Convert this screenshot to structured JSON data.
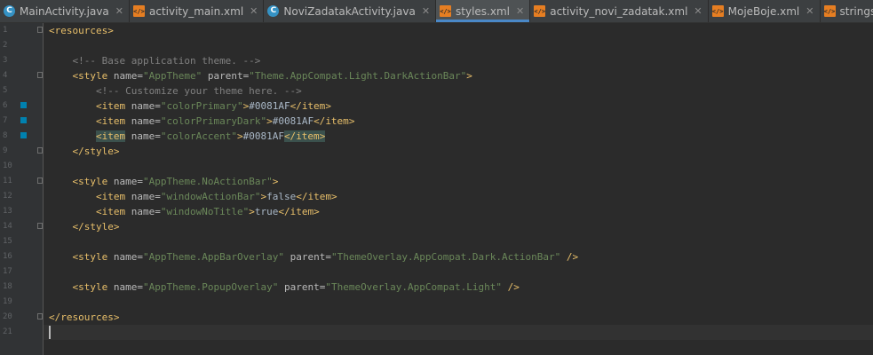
{
  "tabs": [
    {
      "label": "MainActivity.java",
      "kind": "java",
      "active": false
    },
    {
      "label": "activity_main.xml",
      "kind": "xml",
      "active": false
    },
    {
      "label": "NoviZadatakActivity.java",
      "kind": "java",
      "active": false
    },
    {
      "label": "styles.xml",
      "kind": "xml",
      "active": true
    },
    {
      "label": "activity_novi_zadatak.xml",
      "kind": "xml",
      "active": false
    },
    {
      "label": "MojeBoje.xml",
      "kind": "xml",
      "active": false
    },
    {
      "label": "strings.xml",
      "kind": "xml",
      "active": false
    }
  ],
  "icons": {
    "java": "java-class-icon",
    "xml": "xml-file-icon",
    "close": "close-icon"
  },
  "tokens": {
    "open_tag": "<",
    "close_tag": ">",
    "end_tag": "</",
    "self_close": " />",
    "equals": "=",
    "resources": "resources",
    "style": "style",
    "item": "item",
    "name": "name",
    "parent": "parent",
    "comment_1": "<!-- Base application theme. -->",
    "comment_2": "<!-- Customize your theme here. -->",
    "apptheme": "\"AppTheme\"",
    "parent_darkactionbar": "\"Theme.AppCompat.Light.DarkActionBar\"",
    "color_primary": "\"colorPrimary\"",
    "color_primary_dark": "\"colorPrimaryDark\"",
    "color_accent": "\"colorAccent\"",
    "color_value": "#0081AF",
    "noactionbar": "\"AppTheme.NoActionBar\"",
    "window_action_bar": "\"windowActionBar\"",
    "window_no_title": "\"windowNoTitle\"",
    "false": "false",
    "true": "true",
    "appbaroverlay": "\"AppTheme.AppBarOverlay\"",
    "parent_dark_actionbar": "\"ThemeOverlay.AppCompat.Dark.ActionBar\"",
    "popupoverlay": "\"AppTheme.PopupOverlay\"",
    "parent_light": "\"ThemeOverlay.AppCompat.Light\""
  },
  "line_numbers": [
    "1",
    "2",
    "3",
    "4",
    "5",
    "6",
    "7",
    "8",
    "9",
    "10",
    "11",
    "12",
    "13",
    "14",
    "15",
    "16",
    "17",
    "18",
    "19",
    "20",
    "21"
  ],
  "color_swatch_lines": [
    6,
    7,
    8
  ],
  "current_line": 21,
  "colors": {
    "swatch": "#0081af",
    "tag": "#e8bf6a",
    "attribute_value": "#6a8759",
    "comment": "#808080",
    "active_tab_underline": "#4a88c7"
  }
}
